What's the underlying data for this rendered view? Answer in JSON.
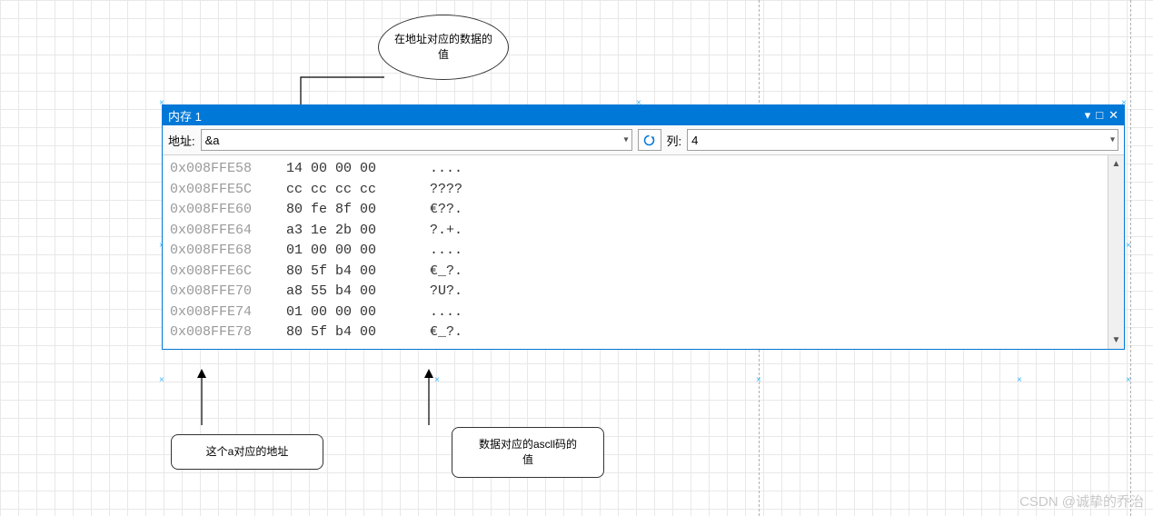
{
  "ellipse_label": "在地址对应的数据的\n值",
  "window": {
    "title": "内存 1",
    "addr_label": "地址:",
    "addr_value": "&a",
    "col_label": "列:",
    "col_value": "4"
  },
  "memory_rows": [
    {
      "addr": "0x008FFE58",
      "hex": "14 00 00 00",
      "asc": "...."
    },
    {
      "addr": "0x008FFE5C",
      "hex": "cc cc cc cc",
      "asc": "????"
    },
    {
      "addr": "0x008FFE60",
      "hex": "80 fe 8f 00",
      "asc": "€??."
    },
    {
      "addr": "0x008FFE64",
      "hex": "a3 1e 2b 00",
      "asc": "?.+."
    },
    {
      "addr": "0x008FFE68",
      "hex": "01 00 00 00",
      "asc": "...."
    },
    {
      "addr": "0x008FFE6C",
      "hex": "80 5f b4 00",
      "asc": "€_?."
    },
    {
      "addr": "0x008FFE70",
      "hex": "a8 55 b4 00",
      "asc": "?U?."
    },
    {
      "addr": "0x008FFE74",
      "hex": "01 00 00 00",
      "asc": "...."
    },
    {
      "addr": "0x008FFE78",
      "hex": "80 5f b4 00",
      "asc": "€_?."
    }
  ],
  "callouts": {
    "left": "这个a对应的地址",
    "right": "数据对应的ascll码的\n值"
  },
  "watermark": "CSDN @诚挚的乔治"
}
